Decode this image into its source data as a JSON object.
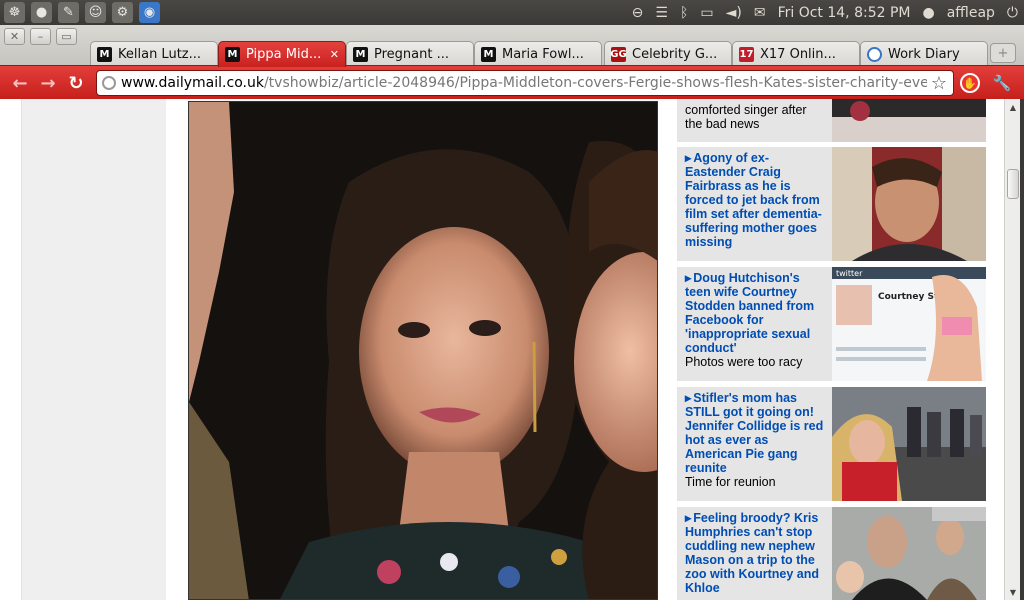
{
  "panel": {
    "datetime": "Fri Oct 14,  8:52 PM",
    "user": "affleap"
  },
  "tabs": [
    {
      "label": "Kellan Lutz...",
      "icon": "dailymail-icon",
      "fav": "M",
      "active": false
    },
    {
      "label": "Pippa Mid...",
      "icon": "dailymail-icon",
      "fav": "M",
      "active": true
    },
    {
      "label": "Pregnant ...",
      "icon": "dailymail-icon",
      "fav": "M",
      "active": false
    },
    {
      "label": "Maria Fowl...",
      "icon": "dailymail-icon",
      "fav": "M",
      "active": false
    },
    {
      "label": "Celebrity G...",
      "icon": "gg-icon",
      "fav": "GG",
      "active": false
    },
    {
      "label": "X17 Onlin...",
      "icon": "x17-icon",
      "fav": "17",
      "active": false
    },
    {
      "label": "Work Diary",
      "icon": "workdiary-icon",
      "fav": "",
      "active": false
    }
  ],
  "address": {
    "host": "www.dailymail.co.uk",
    "path": "/tvshowbiz/article-2048946/Pippa-Middleton-covers-Fergie-shows-flesh-Kates-sister-charity-eve"
  },
  "sidebar": {
    "stories": [
      {
        "headline": "",
        "subtext": "comforted singer after the bad news",
        "plain": true
      },
      {
        "headline": "Agony of ex-Eastender Craig Fairbrass as he is forced to jet back from film set after dementia-suffering mother goes missing",
        "subtext": ""
      },
      {
        "headline": "Doug Hutchison's teen wife Courtney Stodden banned from Facebook for 'inappropriate sexual conduct'",
        "subtext": "Photos were too racy"
      },
      {
        "headline": "Stifler's mom has STILL got it going on! Jennifer Collidge is red hot as ever as American Pie gang reunite",
        "subtext": "Time for reunion"
      },
      {
        "headline": "Feeling broody? Kris Humphries can't stop cuddling new nephew Mason on a trip to the zoo with Kourtney and Khloe",
        "subtext": ""
      }
    ],
    "twitter_thumb": {
      "brand": "twitter",
      "name": "Courtney St"
    }
  },
  "colors": {
    "accent": "#c8221f",
    "link": "#004db3"
  }
}
